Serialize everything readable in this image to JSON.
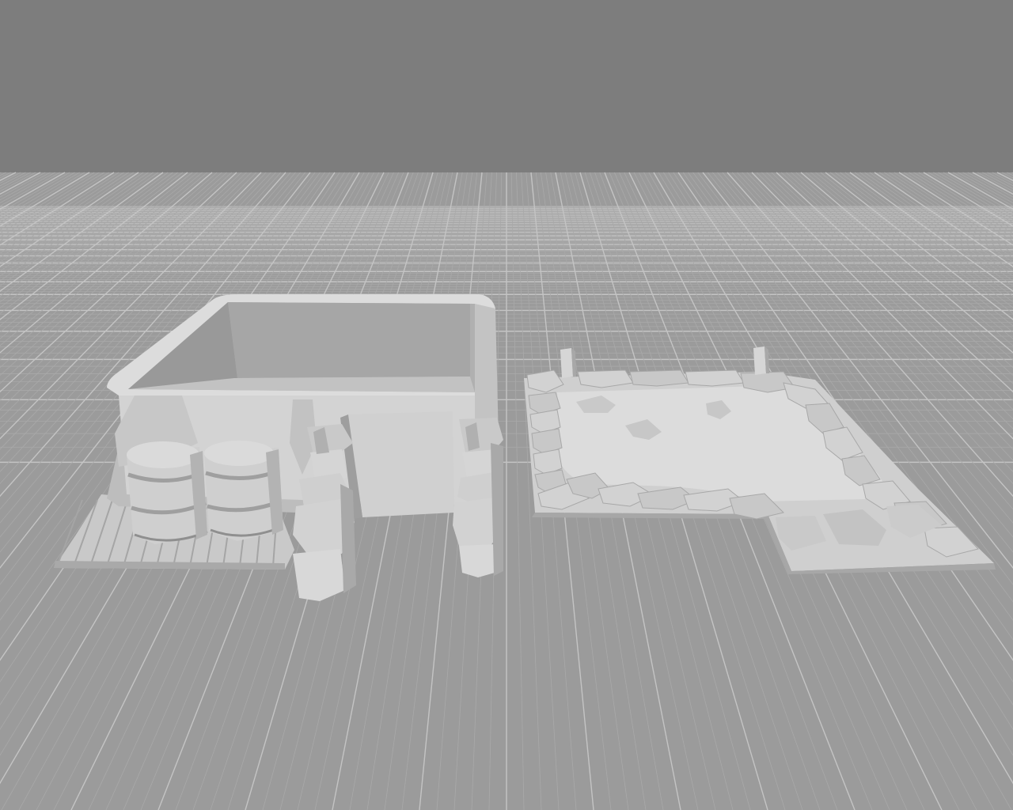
{
  "viewport": {
    "name": "3d-model-preview-viewport",
    "background_color": "#7d7d7d",
    "ground_color": "#9b9b9b",
    "grid_minor_color": "#a9a9a9",
    "grid_major_color": "#c4c4c4",
    "model_light_color": "#d8d8d8",
    "model_mid_color": "#c6c6c6",
    "model_dark_color": "#a9a9a9",
    "model_shadow_color": "#8f8f8f"
  },
  "objects": [
    {
      "name": "bunker-model",
      "parts": [
        "walls",
        "door",
        "sandbag-pillars",
        "barrels",
        "wooden-pallet"
      ]
    },
    {
      "name": "sandbag-trench-base-model",
      "parts": [
        "base-plate",
        "sandbag-rim",
        "posts",
        "rocks"
      ]
    }
  ]
}
